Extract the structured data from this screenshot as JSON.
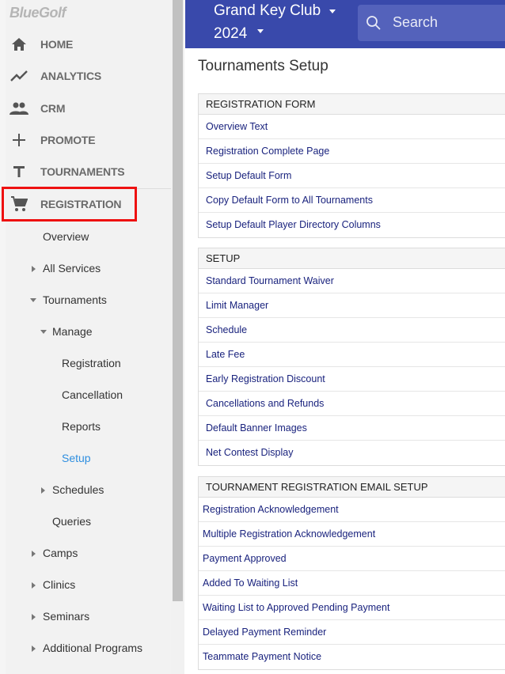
{
  "sidebar": {
    "logo": "BlueGolf",
    "nav": [
      {
        "label": "HOME",
        "icon": "home-icon"
      },
      {
        "label": "ANALYTICS",
        "icon": "analytics-icon"
      },
      {
        "label": "CRM",
        "icon": "people-icon"
      },
      {
        "label": "PROMOTE",
        "icon": "plus-icon"
      },
      {
        "label": "TOURNAMENTS",
        "icon": "text-t-icon"
      },
      {
        "label": "REGISTRATION",
        "icon": "cart-icon"
      }
    ],
    "sub": {
      "overview": "Overview",
      "all_services": "All Services",
      "tournaments": "Tournaments",
      "manage": "Manage",
      "registration": "Registration",
      "cancellation": "Cancellation",
      "reports": "Reports",
      "setup": "Setup",
      "schedules": "Schedules",
      "queries": "Queries",
      "camps": "Camps",
      "clinics": "Clinics",
      "seminars": "Seminars",
      "additional_programs": "Additional Programs"
    }
  },
  "header": {
    "club_name": "Grand Key Club",
    "year": "2024",
    "search_label": "Search"
  },
  "main": {
    "title": "Tournaments Setup",
    "panels": {
      "registration_form": {
        "header": "REGISTRATION FORM",
        "items": [
          "Overview Text",
          "Registration Complete Page",
          "Setup Default Form",
          "Copy Default Form to All Tournaments",
          "Setup Default Player Directory Columns"
        ]
      },
      "setup": {
        "header": "SETUP",
        "items": [
          "Standard Tournament Waiver",
          "Limit Manager",
          "Schedule",
          "Late Fee",
          "Early Registration Discount",
          "Cancellations and Refunds",
          "Default Banner Images",
          "Net Contest Display"
        ]
      },
      "email_setup": {
        "header": "TOURNAMENT REGISTRATION EMAIL SETUP",
        "items": [
          "Registration Acknowledgement",
          "Multiple Registration Acknowledgement",
          "Payment Approved",
          "Added To Waiting List",
          "Waiting List to Approved Pending Payment",
          "Delayed Payment Reminder",
          "Teammate Payment Notice"
        ]
      }
    }
  },
  "colors": {
    "header_bg": "#3949ab",
    "link": "#1a237e",
    "active_sub": "#2f8fe0",
    "highlight": "#ee1111"
  }
}
